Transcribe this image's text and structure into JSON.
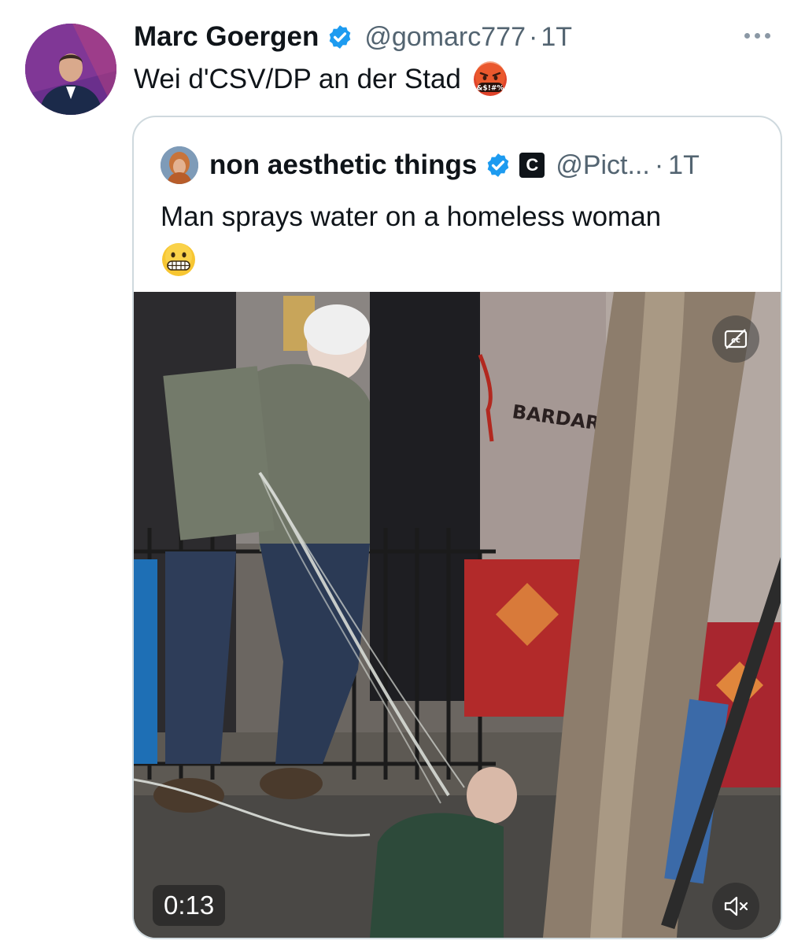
{
  "tweet": {
    "author_name": "Marc Goergen",
    "author_handle": "@gomarc777",
    "separator": "·",
    "time": "1T",
    "text": "Wei d'CSV/DP an der Stad",
    "emoji": "face-with-symbols-on-mouth",
    "verified_color": "#1d9bf0"
  },
  "quoted_tweet": {
    "author_name": "non aesthetic things",
    "badge_letter": "C",
    "author_handle": "@Pict...",
    "separator": "·",
    "time": "1T",
    "text": "Man sprays water on a homeless woman",
    "emoji": "grimacing-face",
    "video": {
      "duration": "0:13",
      "muted": true,
      "captions": "off",
      "scene_sign_text": "BARDARO"
    }
  }
}
